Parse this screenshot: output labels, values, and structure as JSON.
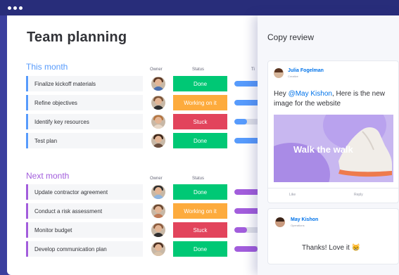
{
  "window": {
    "dot_count": 3
  },
  "board": {
    "title": "Team planning",
    "columns": {
      "owner": "Owner",
      "status": "Status",
      "timeline": "Ti"
    }
  },
  "groups": [
    {
      "title": "This month",
      "color": "#579bfc",
      "rows": [
        {
          "task": "Finalize kickoff materials",
          "status": "Done",
          "status_color": "#00c875",
          "progress": 0.75,
          "timeline_color": "#579bfc"
        },
        {
          "task": "Refine objectives",
          "status": "Working on it",
          "status_color": "#fdab3d",
          "progress": 0.9,
          "timeline_color": "#579bfc"
        },
        {
          "task": "Identify key resources",
          "status": "Stuck",
          "status_color": "#e2445c",
          "progress": 0.35,
          "timeline_color": "#579bfc"
        },
        {
          "task": "Test plan",
          "status": "Done",
          "status_color": "#00c875",
          "progress": 0.75,
          "timeline_color": "#579bfc"
        }
      ]
    },
    {
      "title": "Next month",
      "color": "#a25ddc",
      "rows": [
        {
          "task": "Update contractor agreement",
          "status": "Done",
          "status_color": "#00c875",
          "progress": 0.8,
          "timeline_color": "#a25ddc"
        },
        {
          "task": "Conduct a risk assessment",
          "status": "Working on it",
          "status_color": "#fdab3d",
          "progress": 0.9,
          "timeline_color": "#a25ddc"
        },
        {
          "task": "Monitor budget",
          "status": "Stuck",
          "status_color": "#e2445c",
          "progress": 0.35,
          "timeline_color": "#a25ddc"
        },
        {
          "task": "Develop communication plan",
          "status": "Done",
          "status_color": "#00c875",
          "progress": 0.65,
          "timeline_color": "#a25ddc"
        }
      ]
    }
  ],
  "panel": {
    "title": "Copy review",
    "update": {
      "author": "Julia Fogelman",
      "author_sub": "Creative",
      "message_prefix": "Hey ",
      "mention": "@May Kishon",
      "message_suffix": ", Here is the new image for the website",
      "image_text": "Walk the walk",
      "actions": [
        "Like",
        "Reply"
      ]
    },
    "reply": {
      "author": "May Kishon",
      "author_sub": "Operations",
      "message": "Thanks! Love it",
      "emoji": "😸"
    }
  }
}
